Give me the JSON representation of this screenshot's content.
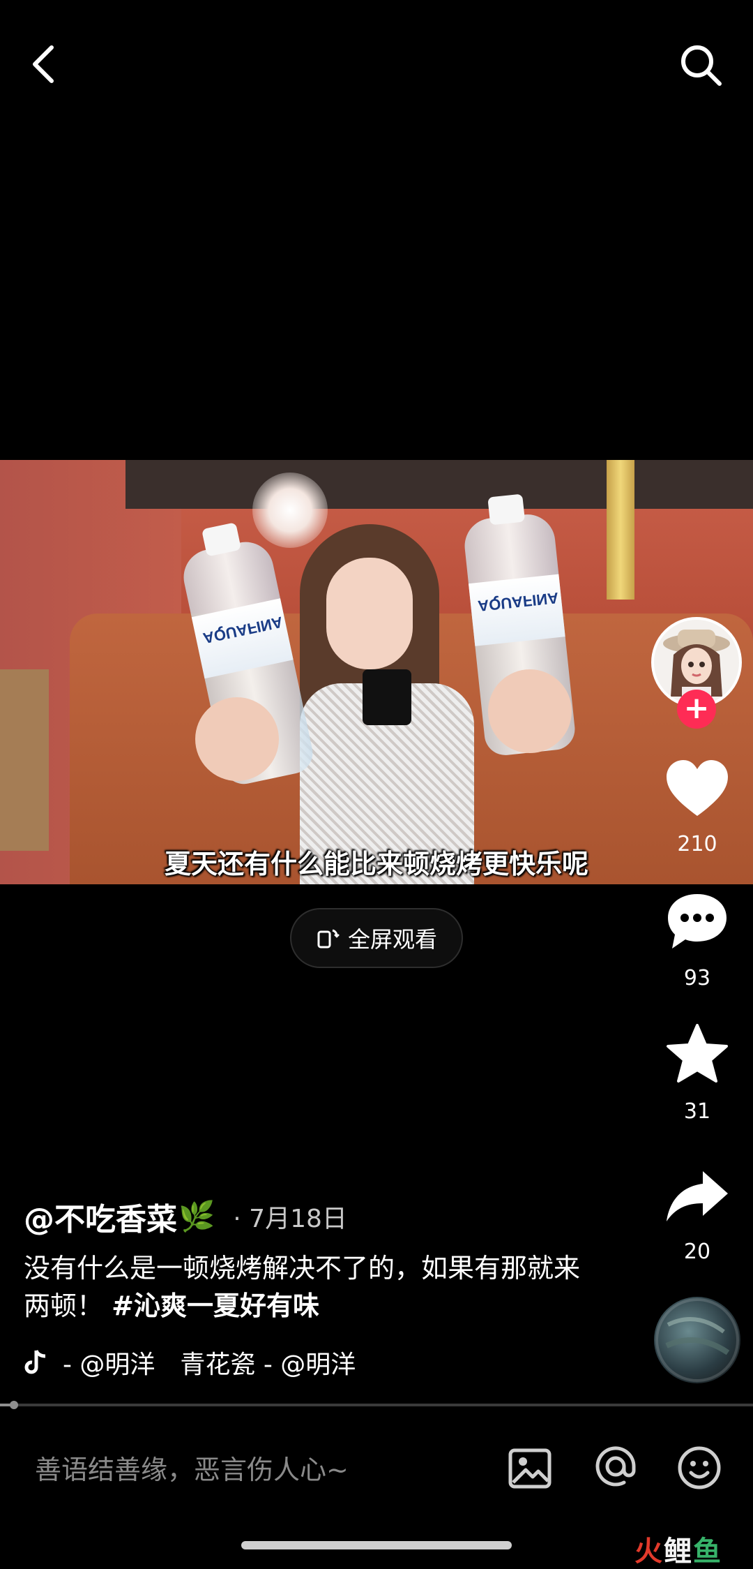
{
  "video": {
    "subtitle": "夏天还有什么能比来顿烧烤更快乐呢",
    "bottle_brand": "AQUAFINA"
  },
  "fullscreen_button": {
    "label": "全屏观看"
  },
  "side_actions": {
    "like_count": "210",
    "comment_count": "93",
    "favorite_count": "31",
    "share_count": "20",
    "follow_symbol": "+"
  },
  "caption": {
    "author": "@不吃香菜",
    "author_emoji": "🌿",
    "date": "· 7月18日",
    "text": "没有什么是一顿烧烤解决不了的，如果有那就来两顿！",
    "hashtag": "#沁爽一夏好有味",
    "music": "- @明洋　青花瓷 - @明洋"
  },
  "comment_bar": {
    "placeholder": "善语结善缘，恶言伤人心~"
  },
  "watermark": {
    "part1": "火",
    "part2": "鲤",
    "part3": "鱼"
  },
  "colors": {
    "accent": "#fe2c55",
    "background": "#000000"
  }
}
